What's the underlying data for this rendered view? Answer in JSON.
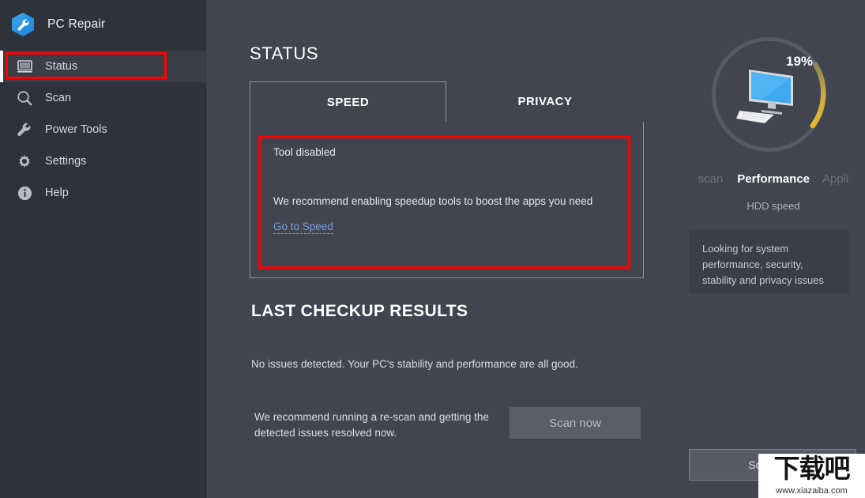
{
  "window": {
    "title": "PC Repair",
    "logo_icon": "hexagon-wrench-logo",
    "minimize_label": "—",
    "close_label": "✕"
  },
  "sidebar": {
    "items": [
      {
        "id": "status",
        "label": "Status",
        "icon": "monitor-icon",
        "active": true
      },
      {
        "id": "scan",
        "label": "Scan",
        "icon": "magnifier-icon",
        "active": false
      },
      {
        "id": "power-tools",
        "label": "Power Tools",
        "icon": "wrench-icon",
        "active": false
      },
      {
        "id": "settings",
        "label": "Settings",
        "icon": "gear-icon",
        "active": false
      },
      {
        "id": "help",
        "label": "Help",
        "icon": "info-icon",
        "active": false
      }
    ],
    "highlight_color": "#ff0000"
  },
  "main": {
    "page_title": "STATUS",
    "tabs": [
      {
        "id": "speed",
        "label": "SPEED",
        "active": true
      },
      {
        "id": "privacy",
        "label": "PRIVACY",
        "active": false
      }
    ],
    "speed_panel": {
      "status": "Tool disabled",
      "description": "We recommend enabling speedup tools to boost the apps you need",
      "link_label": "Go to Speed",
      "link_color": "#7b9ede",
      "highlight_color": "#ff0000"
    },
    "last_checkup": {
      "title": "LAST CHECKUP RESULTS",
      "result": "No issues detected. Your PC's stability and performance are all good.",
      "recommendation": "We recommend running a re-scan and getting the detected issues resolved now.",
      "scan_button_label": "Scan now"
    }
  },
  "right_panel": {
    "gauge": {
      "value_label": "19%",
      "percent": 19,
      "arc_color": "#e8b530",
      "track_color": "#555a64",
      "icon": "desktop-pc-icon"
    },
    "carousel": {
      "previous": "scan",
      "current": "Performance",
      "next": "Appli"
    },
    "metric_label": "HDD speed",
    "info_box_text": "Looking for system performance, security, stability and privacy issues",
    "bottom_button_label": "Scan now"
  },
  "watermark": {
    "text_cn": "下载吧",
    "url": "www.xiazaiba.com"
  }
}
